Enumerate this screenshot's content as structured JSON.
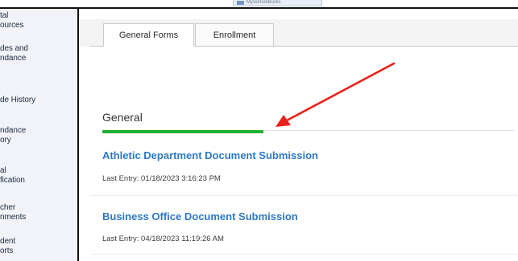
{
  "header": {
    "app_badge": "MySchoolBucks"
  },
  "sidebar": {
    "items": [
      {
        "line1": "tal",
        "line2": "ources"
      },
      {
        "line1": "des and",
        "line2": "ndance"
      },
      {
        "line1": "de History",
        "line2": ""
      },
      {
        "line1": "ndance",
        "line2": "ory"
      },
      {
        "line1": "al",
        "line2": "fication"
      },
      {
        "line1": "cher",
        "line2": "nments"
      },
      {
        "line1": "dent",
        "line2": "orts"
      }
    ]
  },
  "tabs": [
    {
      "label": "General Forms",
      "active": true
    },
    {
      "label": "Enrollment",
      "active": false
    }
  ],
  "section": {
    "title": "General",
    "accent_color": "#22b232"
  },
  "documents": [
    {
      "title": "Athletic Department Document Submission",
      "last_entry": "Last Entry: 01/18/2023 3:16:23 PM"
    },
    {
      "title": "Business Office Document Submission",
      "last_entry": "Last Entry: 04/18/2023 11:19:26 AM"
    }
  ],
  "annotation": {
    "arrow_color": "#e8221b"
  }
}
